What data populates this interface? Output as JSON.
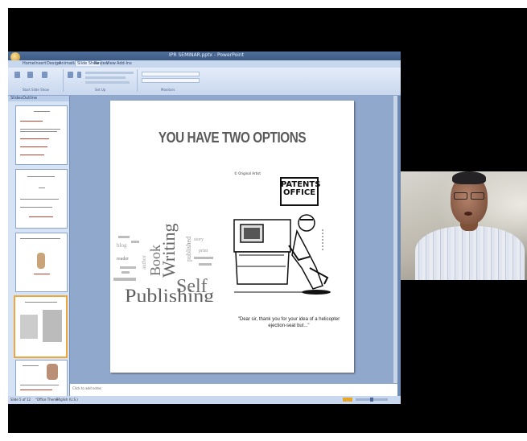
{
  "window": {
    "title": "IPR SEMINAR.pptx - PowerPoint"
  },
  "ribbon": {
    "tabs": [
      "Home",
      "Insert",
      "Design",
      "Animations",
      "Slide Show",
      "Review",
      "View",
      "Add-Ins"
    ],
    "active_tab": "Slide Show",
    "groups": [
      "Start Slide Show",
      "Set Up",
      "Monitors"
    ]
  },
  "pane": {
    "tabs": [
      "Slides",
      "Outline"
    ],
    "thumbs": [
      {
        "num": "",
        "title": ""
      },
      {
        "num": "",
        "title": ""
      },
      {
        "num": "",
        "title": ""
      },
      {
        "num": "",
        "title": ""
      },
      {
        "num": "",
        "title": ""
      }
    ]
  },
  "slide": {
    "title": "YOU HAVE TWO OPTIONS",
    "wordcloud": {
      "words": [
        "Writing",
        "Book",
        "Self",
        "Publishing",
        "article",
        "reader",
        "author",
        "published",
        "blog",
        "print",
        "story"
      ]
    },
    "cartoon": {
      "sign_line1": "PATENTS",
      "sign_line2": "OFFICE",
      "copyright": "© Original Artist",
      "caption": "\"Dear sir, thank you for your idea of a helicopter ejection-seat but...\""
    }
  },
  "notes": {
    "placeholder": "Click to add notes"
  },
  "status": {
    "left": "Slide 5 of 12",
    "theme": "\"Office Theme\"",
    "lang": "English (U.S.)"
  },
  "colors": {
    "ppt_frame": "#6f8bb3",
    "ribbon": "#dbe6f5",
    "selected_thumb_border": "#f0a53a",
    "title_gray": "#5a5a5a"
  }
}
